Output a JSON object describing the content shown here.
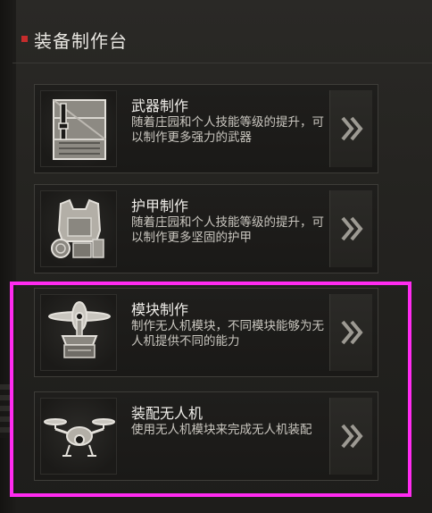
{
  "header": {
    "title": "装备制作台",
    "marker_color": "#c62c2c"
  },
  "cards": [
    {
      "title": "武器制作",
      "description": "随着庄园和个人技能等级的提升，可以制作更多强力的武器",
      "icon": "weapon-crate-icon"
    },
    {
      "title": "护甲制作",
      "description": "随着庄园和个人技能等级的提升，可以制作更多坚固的护甲",
      "icon": "armor-vest-icon"
    },
    {
      "title": "模块制作",
      "description": "制作无人机模块，不同模块能够为无人机提供不同的能力",
      "icon": "drone-module-icon"
    },
    {
      "title": "装配无人机",
      "description": "使用无人机模块来完成无人机装配",
      "icon": "drone-icon"
    }
  ],
  "arrow_icon": "double-chevron-right-icon",
  "highlight": {
    "color": "#ff2bf0",
    "covers": [
      "模块制作",
      "装配无人机"
    ]
  }
}
